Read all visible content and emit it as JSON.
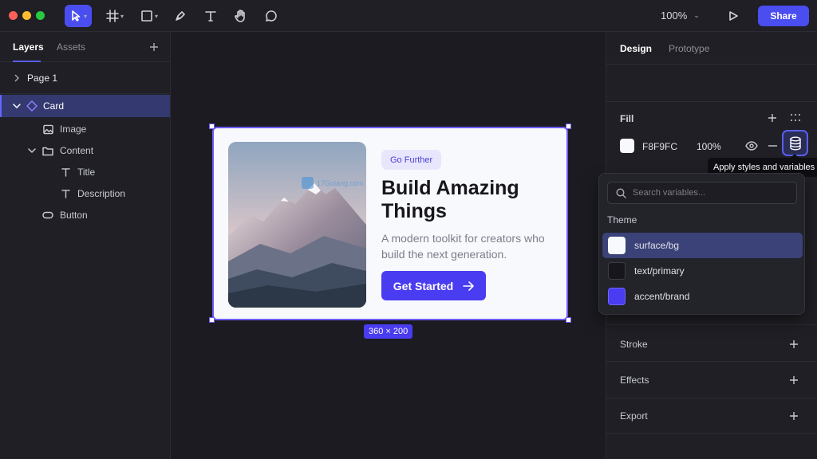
{
  "toolbar": {
    "tools": [
      "move-tool",
      "frame-tool",
      "shape-tool",
      "pen-tool",
      "text-tool",
      "hand-tool",
      "comment-tool"
    ],
    "zoom": "100%",
    "share_label": "Share"
  },
  "left_panel": {
    "tabs": [
      "Layers",
      "Assets"
    ],
    "page": "Page 1",
    "layers": [
      {
        "label": "Card",
        "icon": "component-icon"
      },
      {
        "label": "Image",
        "icon": "image-icon"
      },
      {
        "label": "Content",
        "icon": "folder-icon"
      },
      {
        "label": "Title",
        "icon": "text-icon"
      },
      {
        "label": "Description",
        "icon": "text-icon"
      },
      {
        "label": "Button",
        "icon": "button-icon"
      }
    ]
  },
  "card": {
    "pill": "Go Further",
    "title": "Build Amazing Things",
    "description": "A modern toolkit for creators who build the next generation.",
    "button": "Get Started",
    "dimensions": "360 × 200",
    "colors": {
      "bg": "#F8F9FC",
      "brand": "#4A3CF0",
      "pill_bg": "#E8E6FC"
    }
  },
  "watermark": "17Golang.com",
  "right_panel": {
    "tabs": [
      "Design",
      "Prototype"
    ],
    "fill": {
      "title": "Fill",
      "hex": "F8F9FC",
      "opacity": "100%"
    },
    "tooltip": "Apply styles and variables",
    "variables": {
      "search_placeholder": "Search variables...",
      "group": "Theme",
      "items": [
        {
          "name": "surface/bg",
          "color": "#F8F9FC"
        },
        {
          "name": "text/primary",
          "color": "#16161C"
        },
        {
          "name": "accent/brand",
          "color": "#4A3CF0"
        }
      ]
    },
    "sections": [
      "Stroke",
      "Effects",
      "Export"
    ]
  }
}
